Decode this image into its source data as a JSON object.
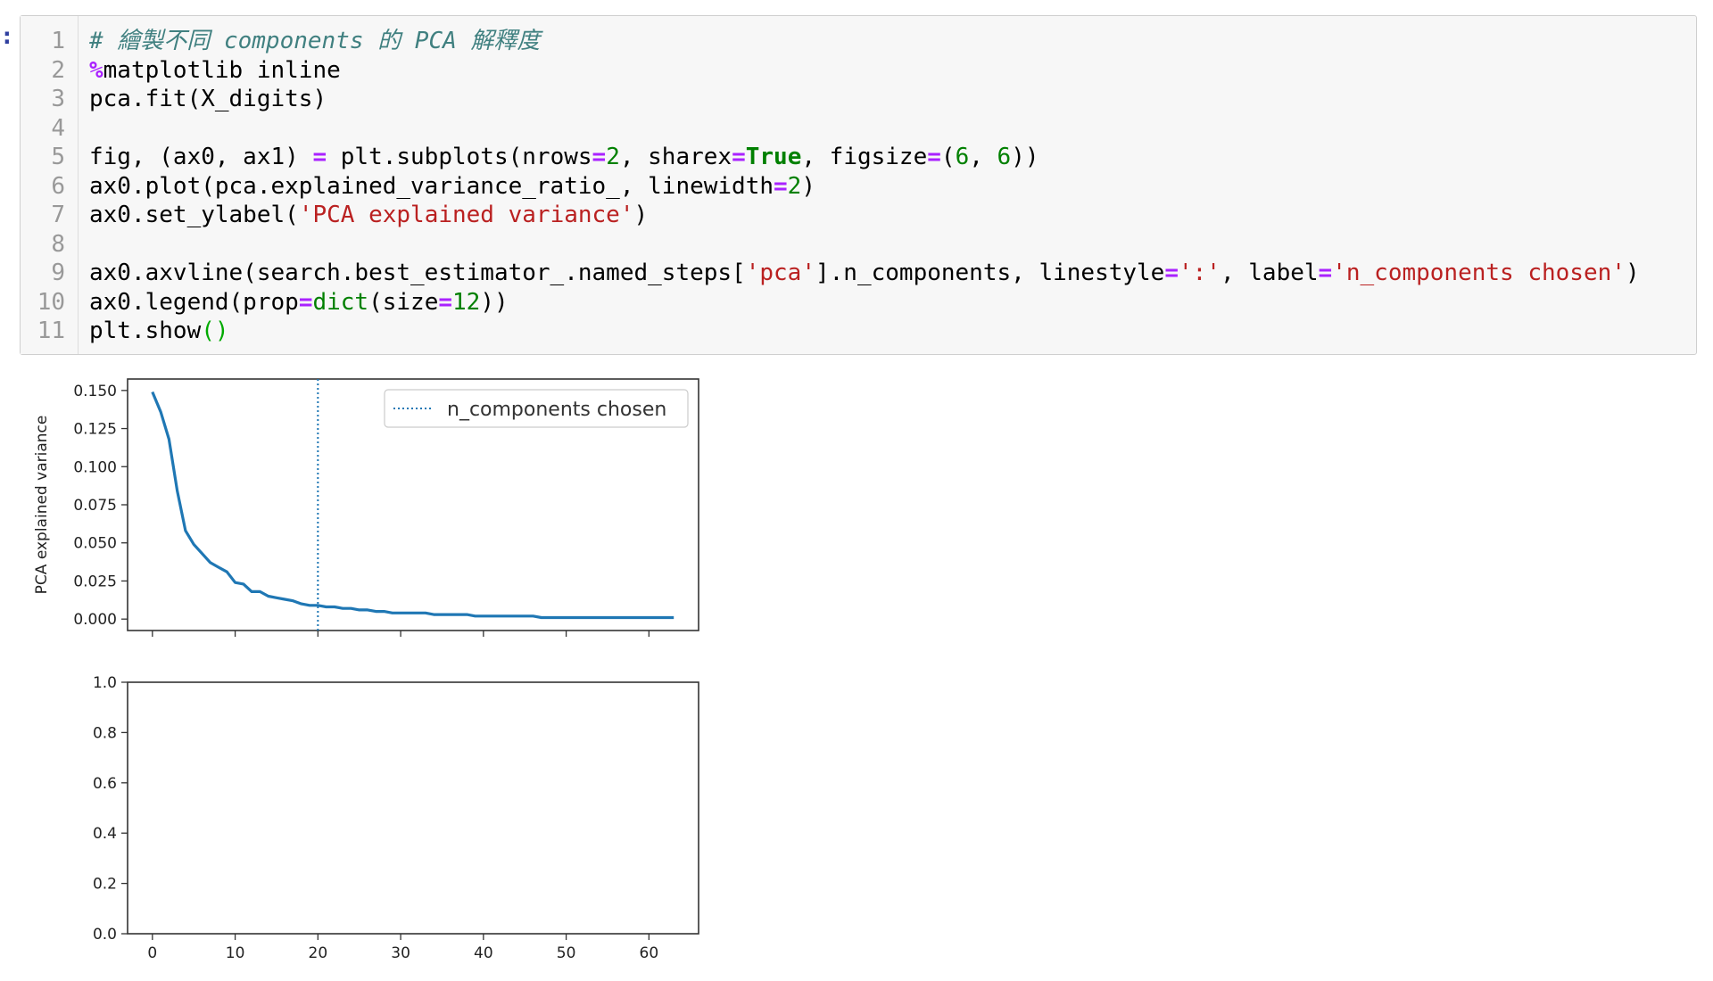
{
  "cell": {
    "prompt_marker": ":",
    "lines": [
      {
        "num": "1",
        "tokens": [
          {
            "t": "# 繪製不同 components 的 PCA 解釋度",
            "c": "comment"
          }
        ]
      },
      {
        "num": "2",
        "tokens": [
          {
            "t": "%",
            "c": "op"
          },
          {
            "t": "matplotlib inline",
            "c": ""
          }
        ]
      },
      {
        "num": "3",
        "tokens": [
          {
            "t": "pca.fit(X_digits)",
            "c": ""
          }
        ]
      },
      {
        "num": "4",
        "tokens": []
      },
      {
        "num": "5",
        "tokens": [
          {
            "t": "fig, (ax0, ax1) ",
            "c": ""
          },
          {
            "t": "=",
            "c": "op"
          },
          {
            "t": " plt.subplots(nrows",
            "c": ""
          },
          {
            "t": "=",
            "c": "op"
          },
          {
            "t": "2",
            "c": "num"
          },
          {
            "t": ", sharex",
            "c": ""
          },
          {
            "t": "=",
            "c": "op"
          },
          {
            "t": "True",
            "c": "kw"
          },
          {
            "t": ", figsize",
            "c": ""
          },
          {
            "t": "=",
            "c": "op"
          },
          {
            "t": "(",
            "c": ""
          },
          {
            "t": "6",
            "c": "num"
          },
          {
            "t": ", ",
            "c": ""
          },
          {
            "t": "6",
            "c": "num"
          },
          {
            "t": "))",
            "c": ""
          }
        ]
      },
      {
        "num": "6",
        "tokens": [
          {
            "t": "ax0.plot(pca.explained_variance_ratio_, linewidth",
            "c": ""
          },
          {
            "t": "=",
            "c": "op"
          },
          {
            "t": "2",
            "c": "num"
          },
          {
            "t": ")",
            "c": ""
          }
        ]
      },
      {
        "num": "7",
        "tokens": [
          {
            "t": "ax0.set_ylabel(",
            "c": ""
          },
          {
            "t": "'PCA explained variance'",
            "c": "str"
          },
          {
            "t": ")",
            "c": ""
          }
        ]
      },
      {
        "num": "8",
        "tokens": []
      },
      {
        "num": "9",
        "tokens": [
          {
            "t": "ax0.axvline(search.best_estimator_.named_steps[",
            "c": ""
          },
          {
            "t": "'pca'",
            "c": "str"
          },
          {
            "t": "].n_components, linestyle",
            "c": ""
          },
          {
            "t": "=",
            "c": "op"
          },
          {
            "t": "':'",
            "c": "str"
          },
          {
            "t": ", label",
            "c": ""
          },
          {
            "t": "=",
            "c": "op"
          },
          {
            "t": "'n_components chosen'",
            "c": "str"
          },
          {
            "t": ")",
            "c": ""
          }
        ]
      },
      {
        "num": "10",
        "tokens": [
          {
            "t": "ax0.legend(prop",
            "c": ""
          },
          {
            "t": "=",
            "c": "op"
          },
          {
            "t": "dict",
            "c": "builtin"
          },
          {
            "t": "(size",
            "c": ""
          },
          {
            "t": "=",
            "c": "op"
          },
          {
            "t": "12",
            "c": "num"
          },
          {
            "t": "))",
            "c": ""
          }
        ]
      },
      {
        "num": "11",
        "tokens": [
          {
            "t": "plt.show",
            "c": ""
          },
          {
            "t": "()",
            "c": "paren"
          }
        ]
      }
    ]
  },
  "chart_data": [
    {
      "type": "line",
      "title": "",
      "xlabel": "",
      "ylabel": "PCA explained variance",
      "xlim": [
        -3,
        66
      ],
      "ylim": [
        -0.0075,
        0.1575
      ],
      "yticks": [
        0.0,
        0.025,
        0.05,
        0.075,
        0.1,
        0.125,
        0.15
      ],
      "ytick_labels": [
        "0.000",
        "0.025",
        "0.050",
        "0.075",
        "0.100",
        "0.125",
        "0.150"
      ],
      "xticks": [
        0,
        10,
        20,
        30,
        40,
        50,
        60
      ],
      "xtick_labels_shown": false,
      "series": [
        {
          "color": "#1f77b4",
          "x": [
            0,
            1,
            2,
            3,
            4,
            5,
            6,
            7,
            8,
            9,
            10,
            11,
            12,
            13,
            14,
            15,
            16,
            17,
            18,
            19,
            20,
            21,
            22,
            23,
            24,
            25,
            26,
            27,
            28,
            29,
            30,
            31,
            32,
            33,
            34,
            35,
            36,
            37,
            38,
            39,
            40,
            41,
            42,
            43,
            44,
            45,
            46,
            47,
            48,
            49,
            50,
            51,
            52,
            53,
            54,
            55,
            56,
            57,
            58,
            59,
            60,
            61,
            62,
            63
          ],
          "values": [
            0.149,
            0.136,
            0.118,
            0.084,
            0.058,
            0.049,
            0.043,
            0.037,
            0.034,
            0.031,
            0.024,
            0.023,
            0.018,
            0.018,
            0.015,
            0.014,
            0.013,
            0.012,
            0.01,
            0.009,
            0.009,
            0.008,
            0.008,
            0.007,
            0.007,
            0.006,
            0.006,
            0.005,
            0.005,
            0.004,
            0.004,
            0.004,
            0.004,
            0.004,
            0.003,
            0.003,
            0.003,
            0.003,
            0.003,
            0.002,
            0.002,
            0.002,
            0.002,
            0.002,
            0.002,
            0.002,
            0.002,
            0.001,
            0.001,
            0.001,
            0.001,
            0.001,
            0.001,
            0.001,
            0.001,
            0.001,
            0.001,
            0.001,
            0.001,
            0.001,
            0.001,
            0.001,
            0.001,
            0.001
          ]
        }
      ],
      "vline": {
        "x": 20,
        "style": "dotted",
        "color": "#1f77b4",
        "label": "n_components chosen"
      },
      "legend": {
        "position": "top-right",
        "entries": [
          "n_components chosen"
        ]
      },
      "grid": false
    },
    {
      "type": "line",
      "title": "",
      "xlabel": "",
      "ylabel": "",
      "xlim": [
        -3,
        66
      ],
      "ylim": [
        0,
        1
      ],
      "yticks": [
        0.0,
        0.2,
        0.4,
        0.6,
        0.8,
        1.0
      ],
      "ytick_labels": [
        "0.0",
        "0.2",
        "0.4",
        "0.6",
        "0.8",
        "1.0"
      ],
      "xticks": [
        0,
        10,
        20,
        30,
        40,
        50,
        60
      ],
      "xtick_labels": [
        "0",
        "10",
        "20",
        "30",
        "40",
        "50",
        "60"
      ],
      "series": [],
      "grid": false
    }
  ]
}
